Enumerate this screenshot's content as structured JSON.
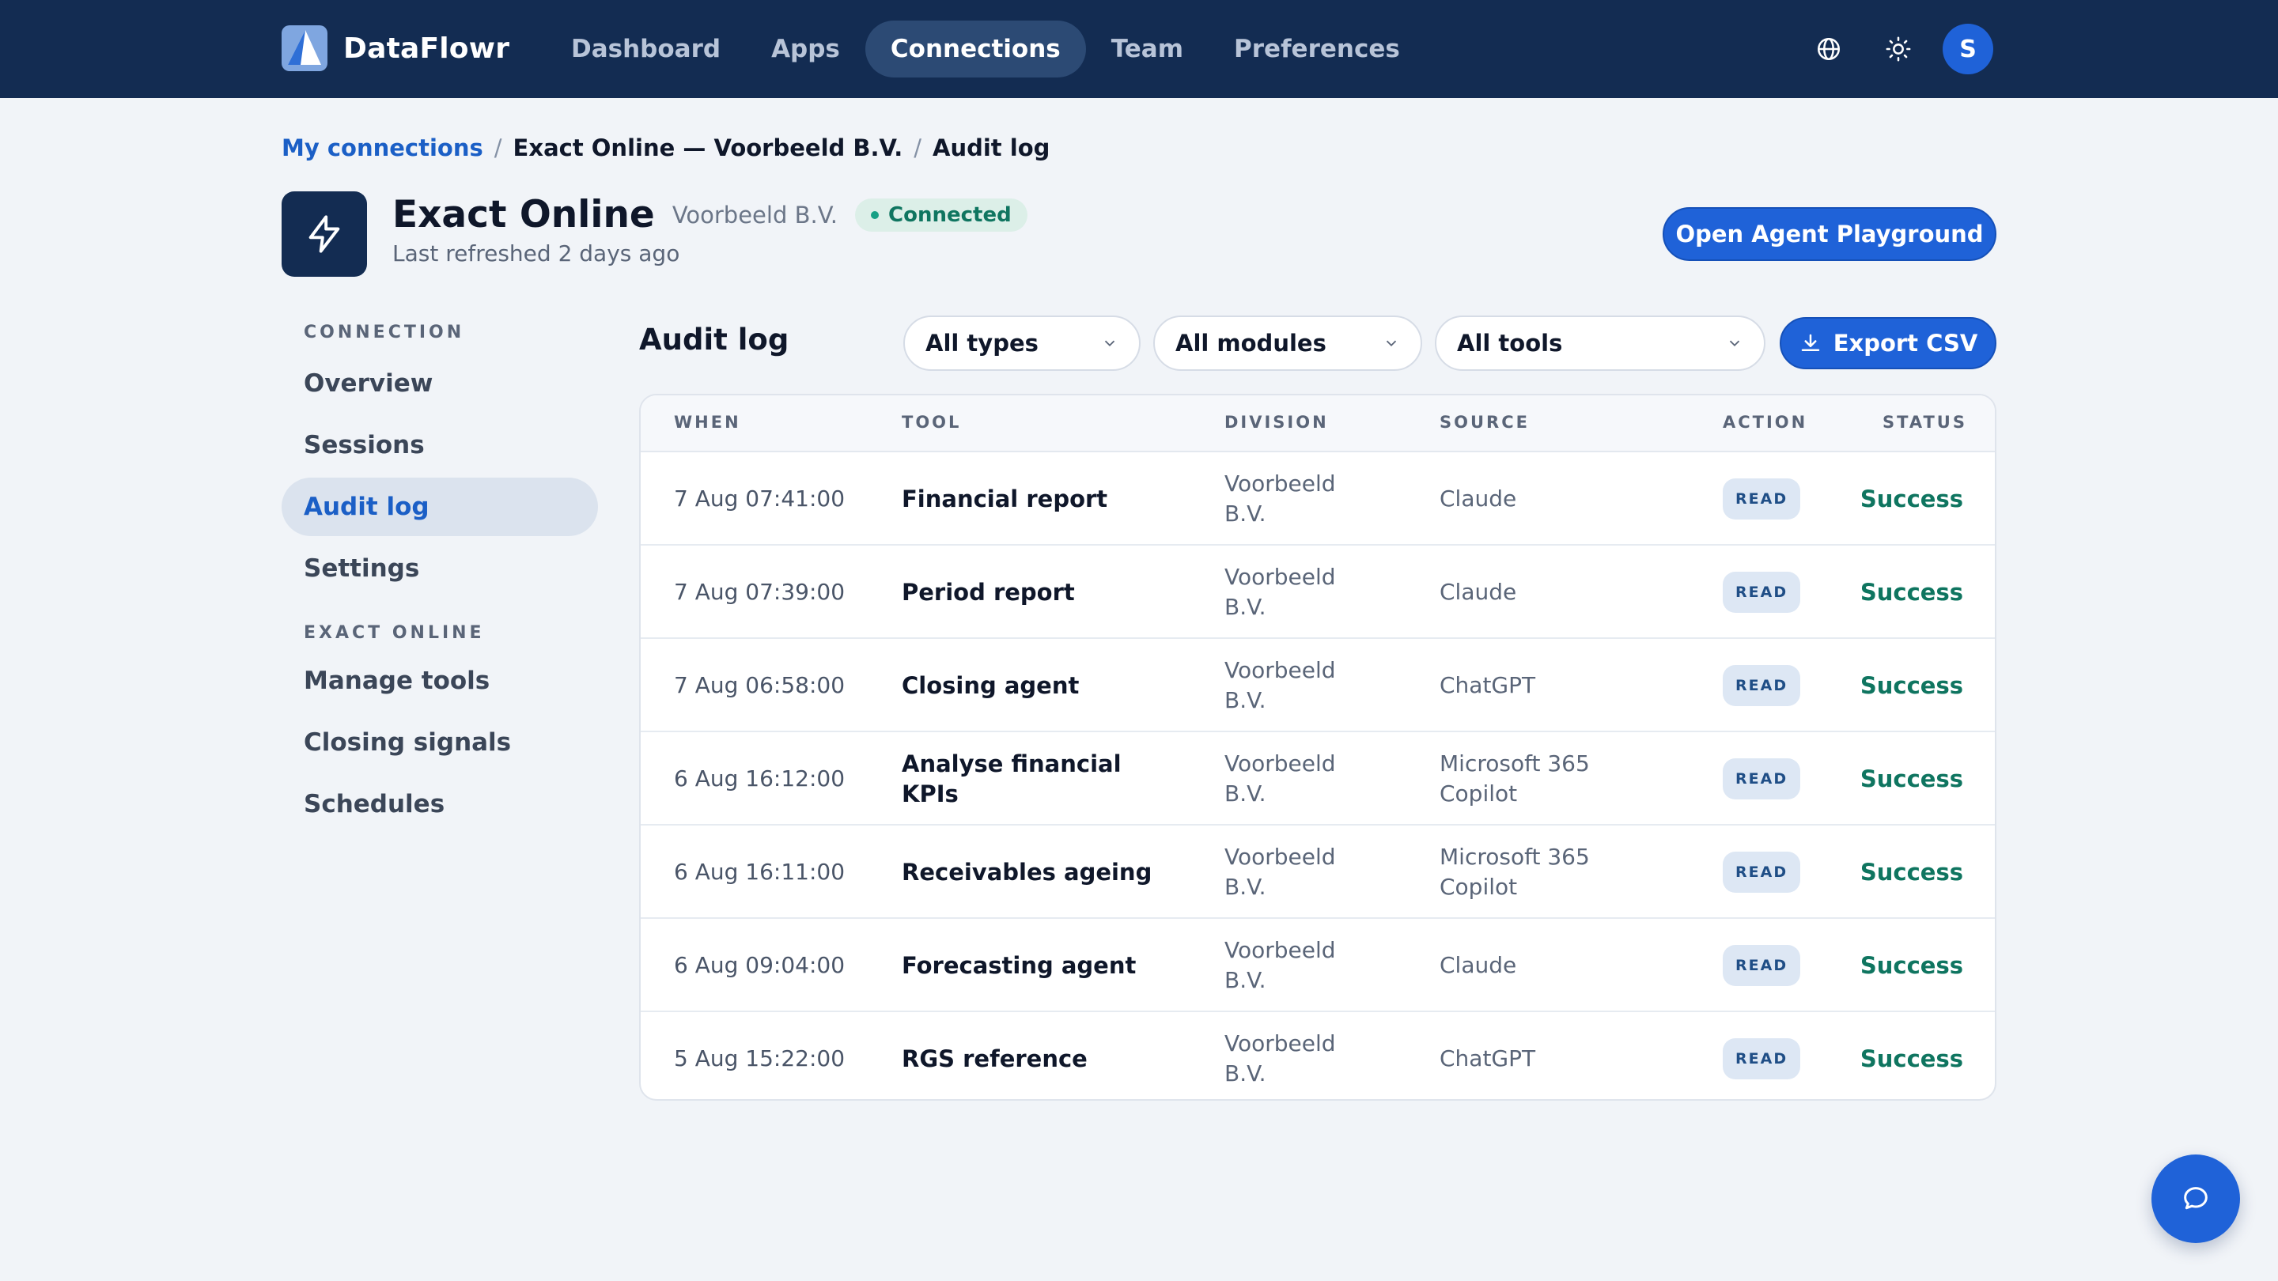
{
  "app": {
    "brand": "DataFlowr",
    "avatar_initial": "S"
  },
  "nav": {
    "items": [
      {
        "label": "Dashboard",
        "active": false
      },
      {
        "label": "Apps",
        "active": false
      },
      {
        "label": "Connections",
        "active": true
      },
      {
        "label": "Team",
        "active": false
      },
      {
        "label": "Preferences",
        "active": false
      }
    ]
  },
  "header_icons": [
    "globe-icon",
    "sun-icon"
  ],
  "breadcrumb": {
    "root": "My connections",
    "middle": "Exact Online — Voorbeeld B.V.",
    "current": "Audit log",
    "separator": "/"
  },
  "connection": {
    "name": "Exact Online",
    "org": "Voorbeeld B.V.",
    "status": "Connected",
    "subtitle": "Last refreshed 2 days ago",
    "playground_button": "Open Agent Playground"
  },
  "sidebar": {
    "section_connection": "CONNECTION",
    "connection_items": [
      {
        "label": "Overview",
        "active": false
      },
      {
        "label": "Sessions",
        "active": false
      },
      {
        "label": "Audit log",
        "active": true
      },
      {
        "label": "Settings",
        "active": false
      }
    ],
    "section_app": "EXACT ONLINE",
    "app_items": [
      {
        "label": "Manage tools"
      },
      {
        "label": "Closing signals"
      },
      {
        "label": "Schedules"
      }
    ]
  },
  "audit": {
    "title": "Audit log",
    "filters": {
      "types": "All types",
      "modules": "All modules",
      "tools": "All tools"
    },
    "export_button": "Export CSV",
    "columns": [
      "WHEN",
      "TOOL",
      "DIVISION",
      "SOURCE",
      "ACTION",
      "STATUS"
    ],
    "rows": [
      {
        "when": "7 Aug 07:41:00",
        "tool": "Financial report",
        "division": "Voorbeeld B.V.",
        "source": "Claude",
        "action": "READ",
        "status": "Success"
      },
      {
        "when": "7 Aug 07:39:00",
        "tool": "Period report",
        "division": "Voorbeeld B.V.",
        "source": "Claude",
        "action": "READ",
        "status": "Success"
      },
      {
        "when": "7 Aug 06:58:00",
        "tool": "Closing agent",
        "division": "Voorbeeld B.V.",
        "source": "ChatGPT",
        "action": "READ",
        "status": "Success"
      },
      {
        "when": "6 Aug 16:12:00",
        "tool": "Analyse financial KPIs",
        "division": "Voorbeeld B.V.",
        "source": "Microsoft 365 Copilot",
        "action": "READ",
        "status": "Success"
      },
      {
        "when": "6 Aug 16:11:00",
        "tool": "Receivables ageing",
        "division": "Voorbeeld B.V.",
        "source": "Microsoft 365 Copilot",
        "action": "READ",
        "status": "Success"
      },
      {
        "when": "6 Aug 09:04:00",
        "tool": "Forecasting agent",
        "division": "Voorbeeld B.V.",
        "source": "Claude",
        "action": "READ",
        "status": "Success"
      },
      {
        "when": "5 Aug 15:22:00",
        "tool": "RGS reference",
        "division": "Voorbeeld B.V.",
        "source": "ChatGPT",
        "action": "READ",
        "status": "Success"
      }
    ]
  },
  "colors": {
    "header_bg": "#132c52",
    "accent": "#1f62d8",
    "success": "#0f7560",
    "page_bg": "#f1f4f8"
  }
}
